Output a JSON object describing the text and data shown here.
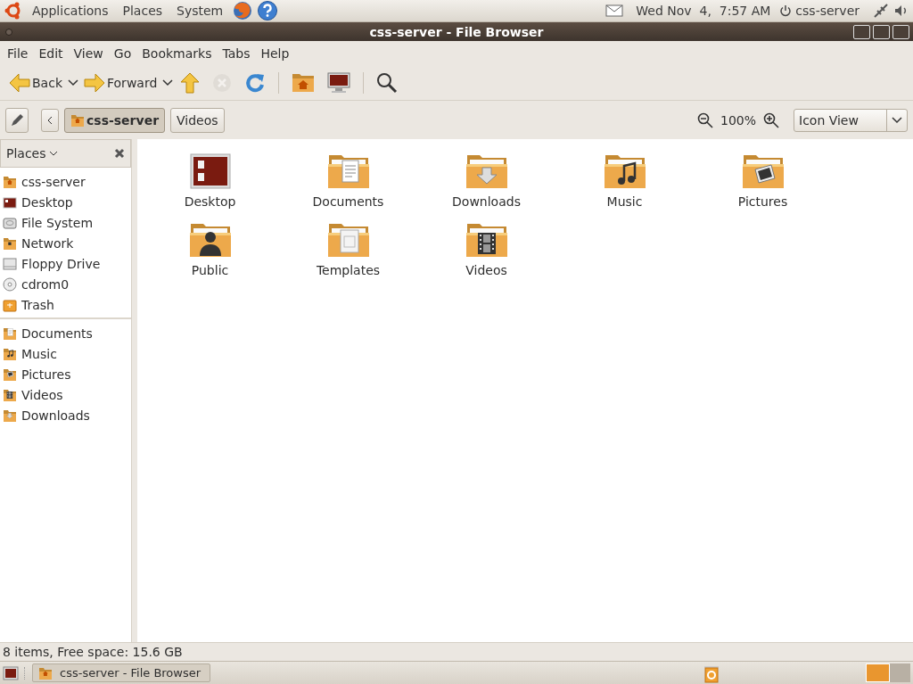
{
  "top_panel": {
    "menus": [
      "Applications",
      "Places",
      "System"
    ],
    "clock": "Wed Nov  4,  7:57 AM",
    "user": "css-server"
  },
  "window": {
    "title": "css-server - File Browser"
  },
  "menubar": [
    "File",
    "Edit",
    "View",
    "Go",
    "Bookmarks",
    "Tabs",
    "Help"
  ],
  "toolbar": [
    {
      "kind": "back",
      "label": "Back",
      "disabled": false
    },
    {
      "kind": "forward",
      "label": "Forward",
      "disabled": false
    },
    {
      "kind": "up",
      "disabled": false
    },
    {
      "kind": "stop",
      "disabled": true
    },
    {
      "kind": "reload",
      "disabled": false
    },
    {
      "kind": "separator"
    },
    {
      "kind": "home",
      "disabled": false
    },
    {
      "kind": "computer",
      "disabled": false
    },
    {
      "kind": "separator"
    },
    {
      "kind": "search",
      "disabled": false
    }
  ],
  "location": {
    "breadcrumbs": [
      {
        "label": "css-server",
        "selected": true
      },
      {
        "label": "Videos",
        "selected": false
      }
    ],
    "zoom": "100%",
    "view": "Icon View"
  },
  "sidebar": {
    "title": "Places",
    "groups": [
      [
        {
          "label": "css-server",
          "kind": "home"
        },
        {
          "label": "Desktop",
          "kind": "desktop"
        },
        {
          "label": "File System",
          "kind": "drive"
        },
        {
          "label": "Network",
          "kind": "network"
        },
        {
          "label": "Floppy Drive",
          "kind": "floppy"
        },
        {
          "label": "cdrom0",
          "kind": "cdrom"
        },
        {
          "label": "Trash",
          "kind": "trash"
        }
      ],
      [
        {
          "label": "Documents",
          "kind": "documents"
        },
        {
          "label": "Music",
          "kind": "music"
        },
        {
          "label": "Pictures",
          "kind": "pictures"
        },
        {
          "label": "Videos",
          "kind": "videos"
        },
        {
          "label": "Downloads",
          "kind": "downloads"
        }
      ]
    ]
  },
  "files": [
    {
      "name": "Desktop",
      "kind": "desktop"
    },
    {
      "name": "Documents",
      "kind": "documents"
    },
    {
      "name": "Downloads",
      "kind": "downloads"
    },
    {
      "name": "Music",
      "kind": "music"
    },
    {
      "name": "Pictures",
      "kind": "pictures"
    },
    {
      "name": "Public",
      "kind": "public"
    },
    {
      "name": "Templates",
      "kind": "templates"
    },
    {
      "name": "Videos",
      "kind": "videos"
    }
  ],
  "status_bar": "8 items, Free space: 15.6 GB",
  "taskbar": [
    {
      "label": "css-server - File Browser",
      "selected": true
    }
  ]
}
